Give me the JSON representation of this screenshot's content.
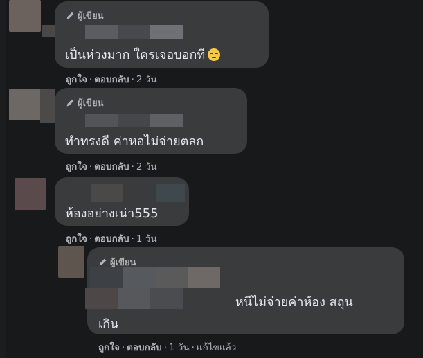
{
  "labels": {
    "author_badge": "ผู้เขียน",
    "like": "ถูกใจ",
    "reply": "ตอบกลับ",
    "edited": "แก้ไขแล้ว"
  },
  "comments": [
    {
      "text": "เป็นห่วงมาก ใครเจอบอกที",
      "time": "2 วัน",
      "emoji": "rolling-eyes-emoji"
    },
    {
      "text": "ทำทรงดี ค่าหอไม่จ่ายตลก",
      "time": "2 วัน"
    },
    {
      "text": "ห้องอย่างเน่า555",
      "time": "1 วัน"
    },
    {
      "text_line1": "หนีไม่จ่ายค่าห้อง สถุน",
      "text_line2": "เกิน",
      "time": "1 วัน"
    }
  ],
  "colors": {
    "background": "#18191a",
    "bubble": "#3a3b3c",
    "text": "#e4e6eb",
    "secondary_text": "#b0b3b8"
  },
  "icons": {
    "author_badge_icon": "pencil-icon"
  }
}
